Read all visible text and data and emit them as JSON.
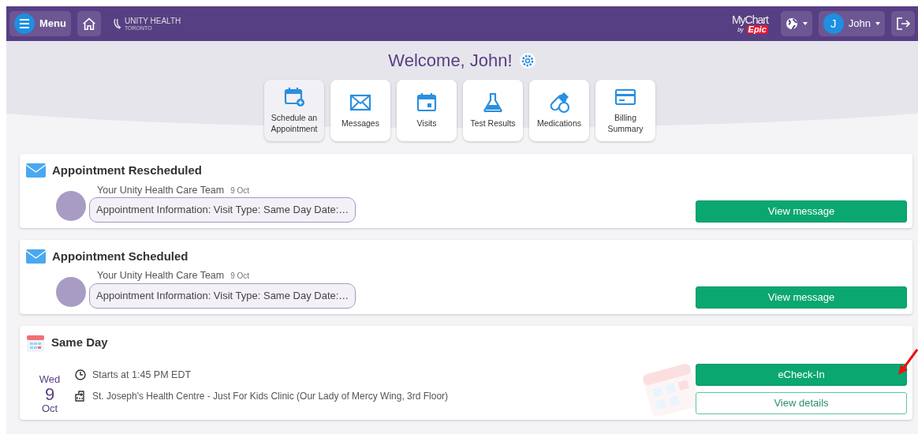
{
  "header": {
    "menu_label": "Menu",
    "logo": {
      "name": "UNITY HEALTH",
      "sub": "TORONTO"
    },
    "brand": {
      "name": "MyChart",
      "by": "by",
      "epic": "Epic"
    },
    "user": {
      "initial": "J",
      "name": "John"
    }
  },
  "welcome": "Welcome, John!",
  "shortcuts": [
    {
      "label": "Schedule an Appointment",
      "kind": "schedule",
      "selected": true
    },
    {
      "label": "Messages",
      "kind": "messages",
      "selected": false
    },
    {
      "label": "Visits",
      "kind": "visits",
      "selected": false
    },
    {
      "label": "Test Results",
      "kind": "tests",
      "selected": false
    },
    {
      "label": "Medications",
      "kind": "medications",
      "selected": false
    },
    {
      "label": "Billing Summary",
      "kind": "billing",
      "selected": false
    }
  ],
  "messages": [
    {
      "title": "Appointment Rescheduled",
      "sender": "Your Unity Health Care Team",
      "date": "9 Oct",
      "preview": "Appointment Information: Visit Type: Same Day Date:…",
      "button": "View message"
    },
    {
      "title": "Appointment Scheduled",
      "sender": "Your Unity Health Care Team",
      "date": "9 Oct",
      "preview": "Appointment Information: Visit Type: Same Day Date:…",
      "button": "View message"
    }
  ],
  "appointment": {
    "title": "Same Day",
    "weekday": "Wed",
    "day": "9",
    "month": "Oct",
    "time": "Starts at 1:45 PM EDT",
    "location": "St. Joseph's Health Centre - Just For Kids Clinic (Our Lady of Mercy Wing, 3rd Floor)",
    "buttons": [
      {
        "label": "eCheck-In",
        "kind": "primary"
      },
      {
        "label": "View details",
        "kind": "outline"
      }
    ]
  }
}
